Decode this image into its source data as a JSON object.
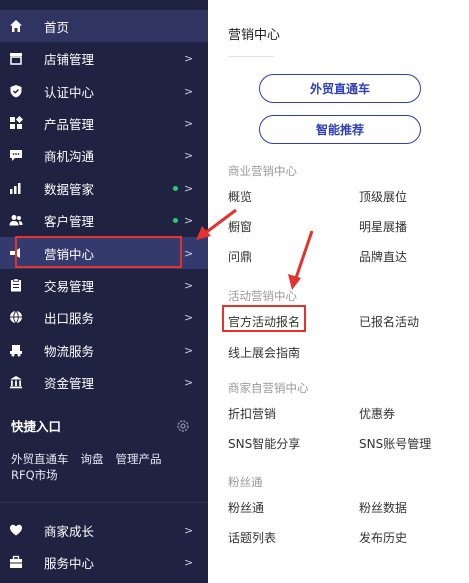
{
  "sidebar": {
    "items": [
      {
        "label": "首页",
        "icon": "home-icon"
      },
      {
        "label": "店铺管理",
        "icon": "store-icon",
        "arrow": ">"
      },
      {
        "label": "认证中心",
        "icon": "shield-icon",
        "arrow": ">"
      },
      {
        "label": "产品管理",
        "icon": "grid-icon",
        "arrow": ">"
      },
      {
        "label": "商机沟通",
        "icon": "chat-icon",
        "arrow": ">"
      },
      {
        "label": "数据管家",
        "icon": "bar-chart-icon",
        "arrow": ">"
      },
      {
        "label": "客户管理",
        "icon": "users-icon",
        "arrow": ">"
      },
      {
        "label": "营销中心",
        "icon": "marketing-icon",
        "arrow": ">"
      },
      {
        "label": "交易管理",
        "icon": "clipboard-icon",
        "arrow": ">"
      },
      {
        "label": "出口服务",
        "icon": "globe-icon",
        "arrow": ">"
      },
      {
        "label": "物流服务",
        "icon": "truck-icon",
        "arrow": ">"
      },
      {
        "label": "资金管理",
        "icon": "bank-icon",
        "arrow": ">"
      }
    ],
    "quick_entry": {
      "title": "快捷入口",
      "links": [
        "外贸直通车",
        "询盘",
        "管理产品",
        "RFQ市场"
      ]
    },
    "bottom_items": [
      {
        "label": "商家成长",
        "icon": "heart-icon",
        "arrow": ">"
      },
      {
        "label": "服务中心",
        "icon": "briefcase-icon",
        "arrow": ">"
      }
    ]
  },
  "panel": {
    "title": "营销中心",
    "buttons": [
      "外贸直通车",
      "智能推荐"
    ],
    "sections": [
      {
        "title": "商业营销中心",
        "links": [
          "概览",
          "顶级展位",
          "橱窗",
          "明星展播",
          "问鼎",
          "品牌直达"
        ]
      },
      {
        "title": "活动营销中心",
        "links": [
          "官方活动报名",
          "已报名活动",
          "线上展会指南"
        ]
      },
      {
        "title": "商家自营销中心",
        "links": [
          "折扣营销",
          "优惠券",
          "SNS智能分享",
          "SNS账号管理"
        ]
      },
      {
        "title": "粉丝通",
        "links": [
          "粉丝通",
          "粉丝数据",
          "话题列表",
          "发布历史"
        ]
      }
    ]
  },
  "colors": {
    "sidebar_bg": "#1f2240",
    "active_bg": "#343a6e",
    "accent_blue": "#2f3fb8",
    "highlight_red": "#e5322d",
    "status_dot": "#2ecc71"
  }
}
